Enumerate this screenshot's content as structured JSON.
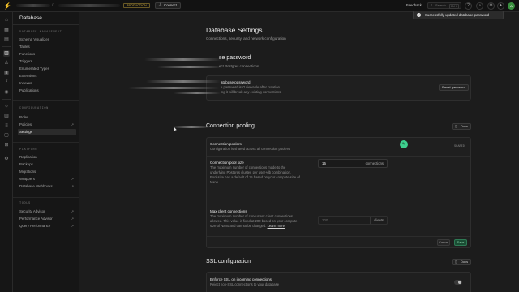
{
  "topbar": {
    "badge": "PRODUCTION",
    "connect_label": "Connect",
    "feedback_label": "Feedback",
    "search_placeholder": "Search...",
    "search_shortcut": "Ctrl K",
    "avatar_initial": "A"
  },
  "toast": {
    "message": "Successfully updated database password"
  },
  "sidebar": {
    "title": "Database",
    "sections": [
      {
        "label": "DATABASE MANAGEMENT",
        "items": [
          "Schema Visualizer",
          "Tables",
          "Functions",
          "Triggers",
          "Enumerated Types",
          "Extensions",
          "Indexes",
          "Publications"
        ]
      },
      {
        "label": "CONFIGURATION",
        "items": [
          "Roles",
          "Policies",
          "Settings"
        ]
      },
      {
        "label": "PLATFORM",
        "items": [
          "Replication",
          "Backups",
          "Migrations",
          "Wrappers",
          "Database Webhooks"
        ]
      },
      {
        "label": "TOOLS",
        "items": [
          "Security Advisor",
          "Performance Advisor",
          "Query Performance"
        ]
      }
    ],
    "active_item": "Settings"
  },
  "page": {
    "title": "Database Settings",
    "subtitle": "Connections, security, and network configuration"
  },
  "password_section": {
    "heading": "se password",
    "description": "ect Postgres connections",
    "row_title": "atabase password",
    "row_desc_1": "e password isn't viewable after creation.",
    "row_desc_2": "ing it will break any existing connections.",
    "reset_label": "Reset password"
  },
  "pooling_section": {
    "heading": "Connection pooling",
    "docs_label": "Docs",
    "poolers_title": "Connection poolers",
    "poolers_desc": "Configuration is shared across all connection poolers",
    "poolers_tag": "SHARED",
    "pool_size_title": "Connection pool size",
    "pool_size_desc": [
      "The maximum number of connections made to the",
      "underlying Postgres cluster, per user+db combination.",
      "Pool size has a default of 15 based on your compute size of",
      "Nano."
    ],
    "pool_size_value": "15",
    "pool_size_suffix": "connections",
    "max_clients_title": "Max client connections",
    "max_clients_desc": [
      "The maximum number of concurrent client connections",
      "allowed. This value is fixed at 200 based on your compute",
      "size of Nano and cannot be changed."
    ],
    "learn_more": "Learn more",
    "max_clients_value": "200",
    "max_clients_suffix": "clients",
    "cancel_label": "Cancel",
    "save_label": "Save"
  },
  "ssl_section": {
    "heading": "SSL configuration",
    "docs_label": "Docs",
    "row_title": "Enforce SSL on incoming connections",
    "row_desc": "Reject non-SSL connections to your database"
  },
  "colors": {
    "accent": "#3ecf8e",
    "background": "#1c1c1c",
    "warning": "#e0b83b"
  }
}
